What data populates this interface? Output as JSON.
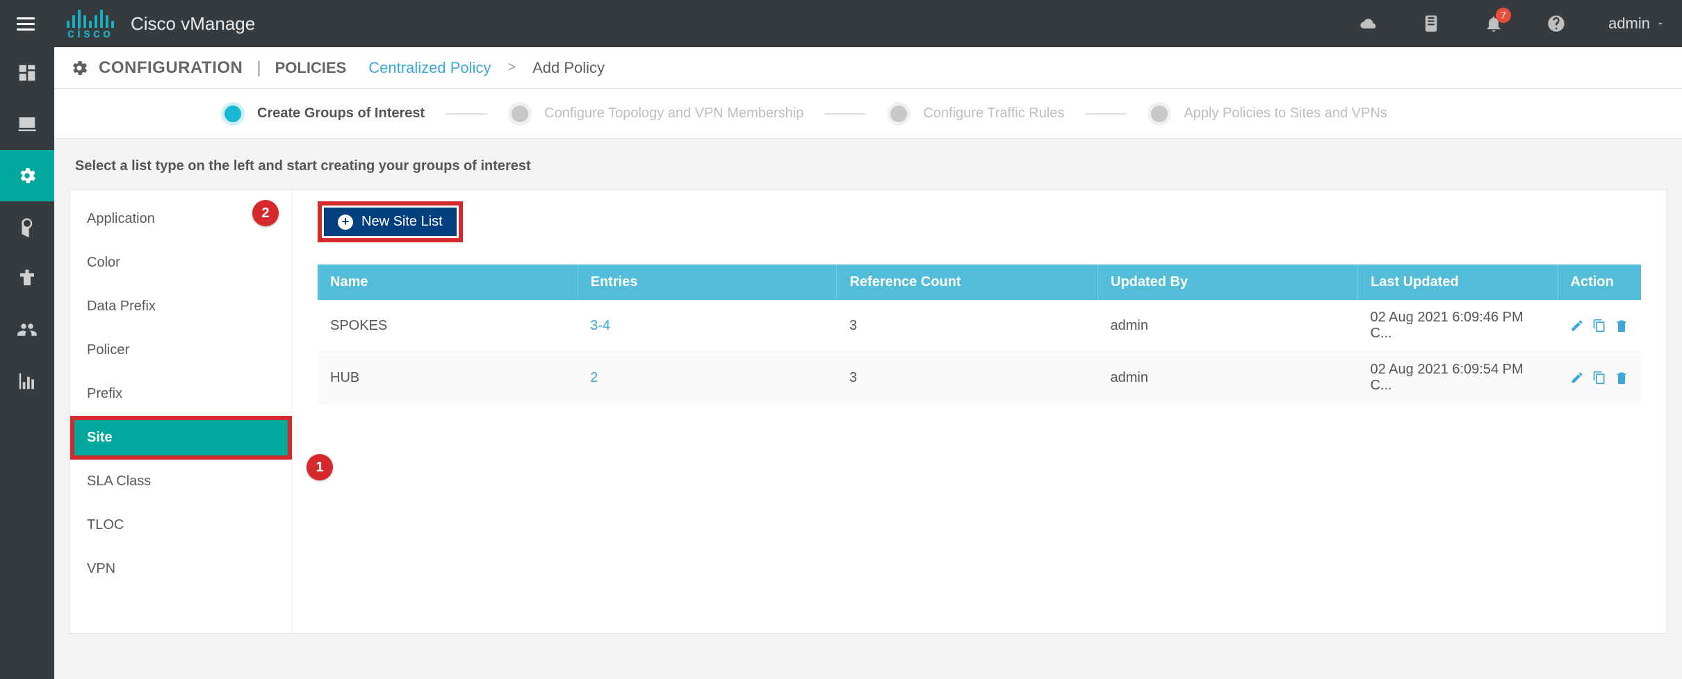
{
  "header": {
    "product": "Cisco vManage",
    "brand_text": "cisco",
    "user": "admin",
    "notification_count": "7"
  },
  "breadcrumb": {
    "section": "CONFIGURATION",
    "subsection": "POLICIES",
    "link": "Centralized Policy",
    "current": "Add Policy"
  },
  "wizard": {
    "steps": [
      "Create Groups of Interest",
      "Configure Topology and VPN Membership",
      "Configure Traffic Rules",
      "Apply Policies to Sites and VPNs"
    ]
  },
  "instruction": "Select a list type on the left and start creating your groups of interest",
  "list_types": [
    "Application",
    "Color",
    "Data Prefix",
    "Policer",
    "Prefix",
    "Site",
    "SLA Class",
    "TLOC",
    "VPN"
  ],
  "annotations": {
    "one": "1",
    "two": "2"
  },
  "new_button": "New Site List",
  "table": {
    "headers": [
      "Name",
      "Entries",
      "Reference Count",
      "Updated By",
      "Last Updated",
      "Action"
    ],
    "rows": [
      {
        "name": "SPOKES",
        "entries": "3-4",
        "ref": "3",
        "updated_by": "admin",
        "last_updated": "02 Aug 2021 6:09:46 PM C..."
      },
      {
        "name": "HUB",
        "entries": "2",
        "ref": "3",
        "updated_by": "admin",
        "last_updated": "02 Aug 2021 6:09:54 PM C..."
      }
    ]
  }
}
